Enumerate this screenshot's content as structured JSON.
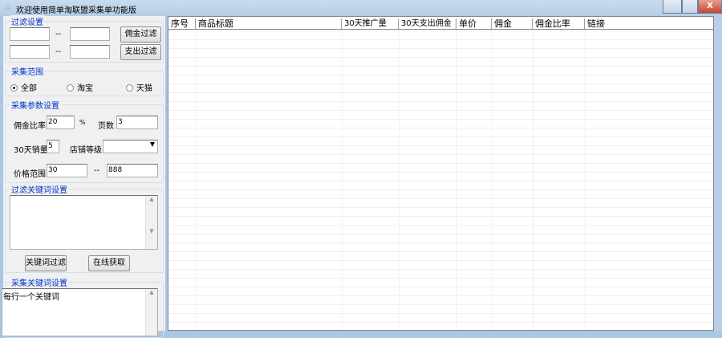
{
  "window": {
    "title": "欢迎使用简单淘联盟采集单功能版",
    "icon": "app-icon",
    "close": "X"
  },
  "filter": {
    "legend": "过滤设置",
    "sep": "--",
    "commission_btn": "佣金过滤",
    "expense_btn": "支出过滤"
  },
  "scope": {
    "legend": "采集范围",
    "options": [
      "全部",
      "淘宝",
      "天猫"
    ],
    "selected": 0
  },
  "params": {
    "legend": "采集参数设置",
    "rate_label": "佣金比率",
    "rate_value": "20",
    "percent": "%",
    "pages_label": "页数",
    "pages_value": "3",
    "sales_label": "30天销量",
    "sales_value": "5",
    "shop_label": "店铺等级",
    "shop_value": "",
    "price_label": "价格范围",
    "price_min": "30",
    "price_sep": "--",
    "price_max": "888"
  },
  "filter_kw": {
    "legend": "过滤关键词设置",
    "filter_btn": "关键词过滤",
    "online_btn": "在线获取"
  },
  "collect_kw": {
    "legend": "采集关键词设置",
    "text": "每行一个关键词"
  },
  "table": {
    "columns": [
      "序号",
      "商品标题",
      "30天推广量",
      "30天支出佣金",
      "单价",
      "佣金",
      "佣金比率",
      "链接"
    ]
  }
}
